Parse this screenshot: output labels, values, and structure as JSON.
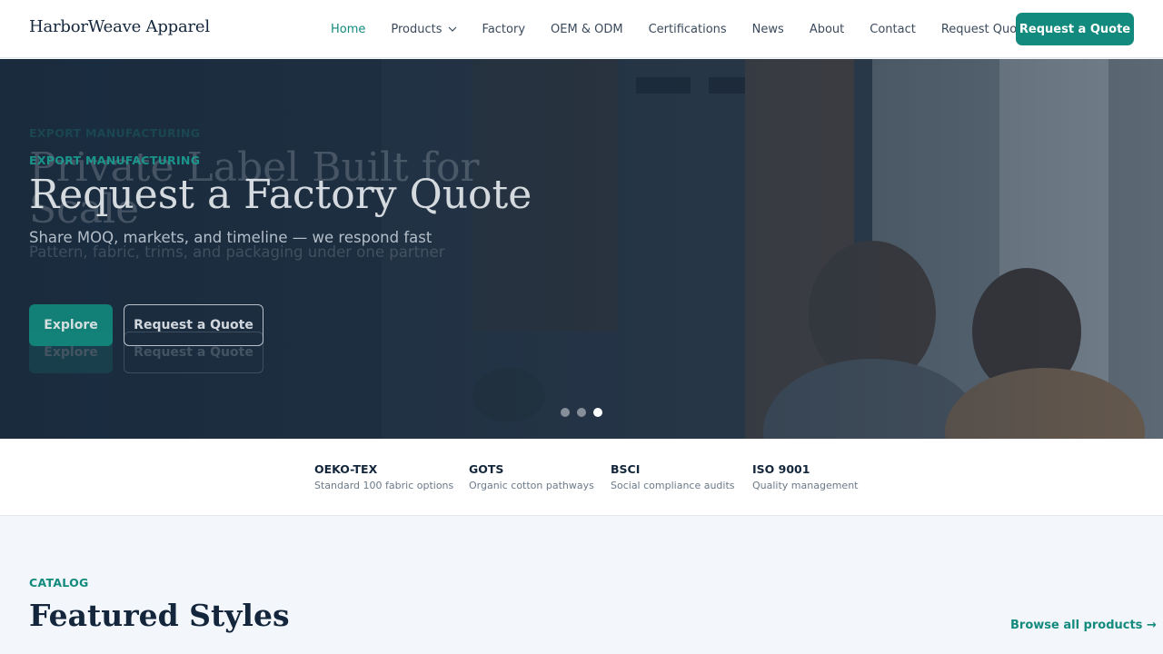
{
  "header": {
    "brand": "HarborWeave Apparel",
    "nav": [
      {
        "label": "Home",
        "active": true
      },
      {
        "label": "Products",
        "has_dropdown": true
      },
      {
        "label": "Factory"
      },
      {
        "label": "OEM & ODM"
      },
      {
        "label": "Certifications"
      },
      {
        "label": "News"
      },
      {
        "label": "About"
      },
      {
        "label": "Contact"
      },
      {
        "label": "Request Quote"
      }
    ],
    "cta_label": "Request a Quote"
  },
  "hero": {
    "current_slide": {
      "eyebrow": "EXPORT MANUFACTURING",
      "title": "Request a Factory Quote",
      "subtitle": "Share MOQ, markets, and timeline — we respond fast",
      "primary_label": "Explore",
      "secondary_label": "Request a Quote"
    },
    "outgoing_slide": {
      "eyebrow": "EXPORT MANUFACTURING",
      "title": "Private Label Built for Scale",
      "subtitle": "Pattern, fabric, trims, and packaging under one partner",
      "primary_label": "Explore",
      "secondary_label": "Request a Quote"
    },
    "slide_count": 3,
    "active_slide_index": 3
  },
  "certifications": [
    {
      "name": "OEKO-TEX",
      "desc": "Standard 100 fabric options"
    },
    {
      "name": "GOTS",
      "desc": "Organic cotton pathways"
    },
    {
      "name": "BSCI",
      "desc": "Social compliance audits"
    },
    {
      "name": "ISO 9001",
      "desc": "Quality management"
    }
  ],
  "catalog": {
    "eyebrow": "CATALOG",
    "title": "Featured Styles",
    "browse_label": "Browse all products →"
  },
  "colors": {
    "accent": "#138a7e",
    "text_dark": "#13263b",
    "hero_overlay": "#1c2e42"
  }
}
